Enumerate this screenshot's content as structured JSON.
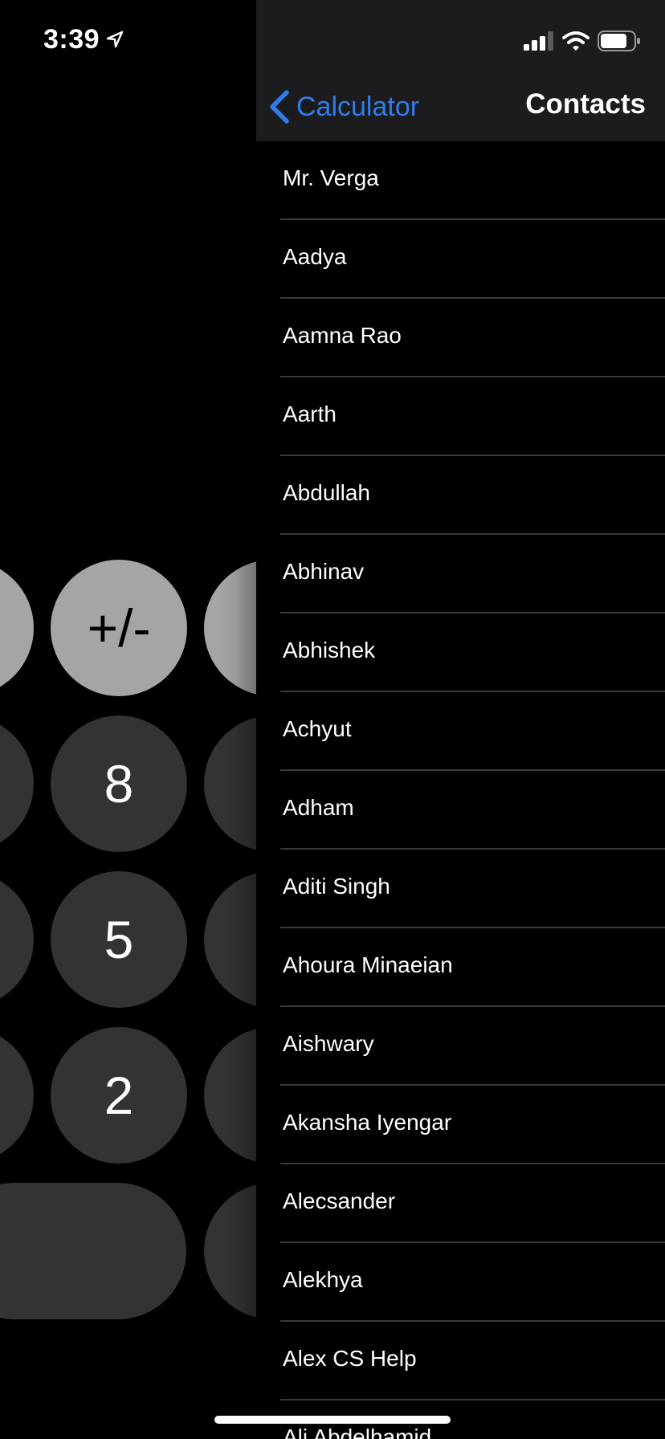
{
  "status_bar": {
    "time": "3:39",
    "location_icon": "location-arrow-icon",
    "cellular_icon": "cellular-signal-icon",
    "wifi_icon": "wifi-icon",
    "battery_icon": "battery-icon"
  },
  "calculator": {
    "visible_keys": {
      "plus_minus": "+/-",
      "eight": "8",
      "five": "5",
      "two": "2"
    }
  },
  "contacts_sheet": {
    "back_label": "Calculator",
    "back_icon": "chevron-left-icon",
    "title": "Contacts",
    "contacts": [
      "Mr. Verga",
      "Aadya",
      "Aamna Rao",
      "Aarth",
      "Abdullah",
      "Abhinav",
      "Abhishek",
      "Achyut",
      "Adham",
      "Aditi Singh",
      "Ahoura Minaeian",
      "Aishwary",
      "Akansha Iyengar",
      "Alecsander",
      "Alekhya",
      "Alex CS Help",
      "Ali Abdelhamid"
    ]
  },
  "colors": {
    "accent": "#2f7dec",
    "navbar_bg": "#1c1c1e",
    "separator": "#3a3a3c",
    "calc_dark_key": "#333333",
    "calc_light_key": "#a5a5a5"
  }
}
